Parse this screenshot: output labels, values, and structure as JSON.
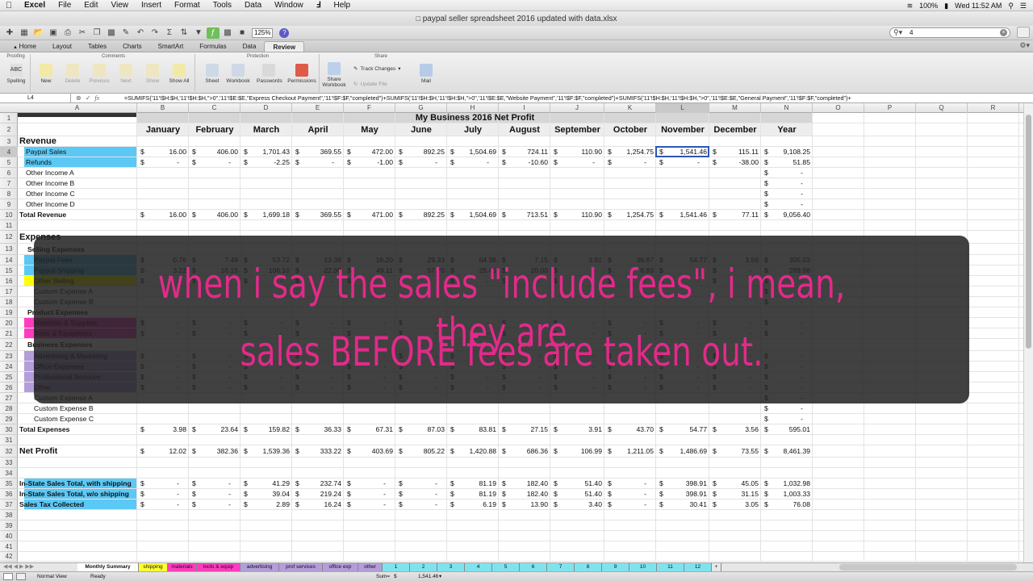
{
  "menubar": {
    "apple": "",
    "items": [
      "Excel",
      "File",
      "Edit",
      "View",
      "Insert",
      "Format",
      "Tools",
      "Data",
      "Window",
      "Help"
    ],
    "script_icon": "script-icon",
    "battery": "100%",
    "clock": "Wed 11:52 AM"
  },
  "window": {
    "title": "paypal seller spreadsheet 2016 updated with data.xlsx"
  },
  "toolbar": {
    "zoom": "125%",
    "search_value": "4"
  },
  "ribbon_tabs": [
    "Home",
    "Layout",
    "Tables",
    "Charts",
    "SmartArt",
    "Formulas",
    "Data",
    "Review"
  ],
  "ribbon_active": "Review",
  "ribbon": {
    "groups": {
      "proofing": "Proofing",
      "comments": "Comments",
      "protection": "Protection",
      "share": "Share"
    },
    "spelling": "Spelling",
    "new": "New",
    "delete": "Delete",
    "previous": "Previous",
    "next": "Next",
    "show": "Show",
    "show_all": "Show All",
    "sheet": "Sheet",
    "workbook": "Workbook",
    "passwords": "Passwords",
    "permissions": "Permissions",
    "share_workbook_1": "Share",
    "share_workbook_2": "Workbook",
    "track_changes": "Track Changes",
    "update_file": "Update File",
    "mail": "Mail"
  },
  "formula_bar": {
    "name_box": "L4",
    "fx": "fx",
    "formula": "=SUMIFS('11'!$H:$H,'11'!$H:$H,\">0\",'11'!$E:$E,\"Express Checkout Payment\",'11'!$F:$F,\"completed\")+SUMIFS('11'!$H:$H,'11'!$H:$H,\">0\",'11'!$E:$E,\"Website Payment\",'11'!$F:$F,\"completed\")+SUMIFS('11'!$H:$H,'11'!$H:$H,\">0\",'11'!$E:$E,\"General Payment\",'11'!$F:$F,\"completed\")+"
  },
  "columns": [
    "A",
    "B",
    "C",
    "D",
    "E",
    "F",
    "G",
    "H",
    "I",
    "J",
    "K",
    "L",
    "M",
    "N",
    "O",
    "P",
    "Q",
    "R"
  ],
  "rows": [
    "1",
    "2",
    "3",
    "4",
    "5",
    "6",
    "7",
    "8",
    "9",
    "10",
    "11",
    "12",
    "13",
    "14",
    "15",
    "16",
    "17",
    "18",
    "19",
    "20",
    "21",
    "22",
    "23",
    "24",
    "25",
    "26",
    "27",
    "28",
    "29",
    "30",
    "31",
    "32",
    "33",
    "34",
    "35",
    "36",
    "37",
    "38",
    "39",
    "40",
    "41",
    "42"
  ],
  "sheet": {
    "title": "My Business 2016 Net Profit",
    "months": [
      "January",
      "February",
      "March",
      "April",
      "May",
      "June",
      "July",
      "August",
      "September",
      "October",
      "November",
      "December",
      "Year"
    ],
    "labels": {
      "r3": "Revenue",
      "r4": "Paypal Sales",
      "r5": "Refunds",
      "r6": "Other Income A",
      "r7": "Other Income B",
      "r8": "Other Income C",
      "r9": "Other Income D",
      "r10": "Total Revenue",
      "r12": "Expenses",
      "r13": "Selling Expenses",
      "r14": "Paypal Fees",
      "r15": "Paypal Shipping",
      "r16": "Other Selling",
      "r17": "Custom Expense A",
      "r18": "Custom Expense B",
      "r19": "Product Expenses",
      "r20": "Materials & Supplies",
      "r21": "Tools & Equipment",
      "r22": "Business Expenses",
      "r23": "Advertising & Marketing",
      "r24": "Office Expenses",
      "r25": "Professional Services",
      "r26": "Other",
      "r27": "Custom Expense A",
      "r28": "Custom Expense B",
      "r29": "Custom Expense C",
      "r30": "Total Expenses",
      "r32": "Net Profit",
      "r35": "In-State Sales Total, with shipping",
      "r36": "In-State Sales Total, w/o shipping",
      "r37": "Sales Tax Collected"
    },
    "dollar": "$",
    "data": {
      "r4": [
        "16.00",
        "406.00",
        "1,701.43",
        "369.55",
        "472.00",
        "892.25",
        "1,504.69",
        "724.11",
        "110.90",
        "1,254.75",
        "1,541.46",
        "115.11",
        "9,108.25"
      ],
      "r5": [
        "-",
        "-",
        "-2.25",
        "-",
        "-1.00",
        "-",
        "-",
        "-10.60",
        "-",
        "-",
        "-",
        "-38.00",
        "51.85"
      ],
      "r6": [
        "",
        "",
        "",
        "",
        "",
        "",
        "",
        "",
        "",
        "",
        "",
        "",
        "-"
      ],
      "r7": [
        "",
        "",
        "",
        "",
        "",
        "",
        "",
        "",
        "",
        "",
        "",
        "",
        "-"
      ],
      "r8": [
        "",
        "",
        "",
        "",
        "",
        "",
        "",
        "",
        "",
        "",
        "",
        "",
        "-"
      ],
      "r9": [
        "",
        "",
        "",
        "",
        "",
        "",
        "",
        "",
        "",
        "",
        "",
        "",
        "-"
      ],
      "r10": [
        "16.00",
        "406.00",
        "1,699.18",
        "369.55",
        "471.00",
        "892.25",
        "1,504.69",
        "713.51",
        "110.90",
        "1,254.75",
        "1,541.46",
        "77.11",
        "9,056.40"
      ],
      "r14": [
        "0.76",
        "7.49",
        "53.72",
        "13.38",
        "18.20",
        "29.33",
        "54.36",
        "7.15",
        "3.91",
        "36.87",
        "54.77",
        "3.56",
        "305.03"
      ],
      "r15": [
        "3.22",
        "16.15",
        "106.10",
        "22.95",
        "49.11",
        "57.70",
        "29.45",
        "20.00",
        "-",
        "6.83",
        "-",
        "-",
        "289.98"
      ],
      "r16": [
        "-",
        "-",
        "-",
        "-",
        "-",
        "-",
        "-",
        "-",
        "-",
        "-",
        "-",
        "-",
        "-"
      ],
      "r17": [
        "",
        "",
        "",
        "",
        "",
        "",
        "",
        "",
        "",
        "",
        "",
        "",
        "-"
      ],
      "r18": [
        "",
        "",
        "",
        "",
        "",
        "",
        "",
        "",
        "",
        "",
        "",
        "",
        "-"
      ],
      "r20": [
        "-",
        "-",
        "-",
        "-",
        "-",
        "-",
        "-",
        "-",
        "-",
        "-",
        "-",
        "-",
        "-"
      ],
      "r21": [
        "-",
        "-",
        "-",
        "-",
        "-",
        "-",
        "-",
        "-",
        "-",
        "-",
        "-",
        "-",
        "-"
      ],
      "r23": [
        "-",
        "-",
        "-",
        "-",
        "-",
        "-",
        "-",
        "-",
        "-",
        "-",
        "-",
        "-",
        "-"
      ],
      "r24": [
        "-",
        "-",
        "-",
        "-",
        "-",
        "-",
        "-",
        "-",
        "-",
        "-",
        "-",
        "-",
        "-"
      ],
      "r25": [
        "-",
        "-",
        "-",
        "-",
        "-",
        "-",
        "-",
        "-",
        "-",
        "-",
        "-",
        "-",
        "-"
      ],
      "r26": [
        "-",
        "-",
        "-",
        "-",
        "-",
        "-",
        "-",
        "-",
        "-",
        "-",
        "-",
        "-",
        "-"
      ],
      "r27": [
        "",
        "",
        "",
        "",
        "",
        "",
        "",
        "",
        "",
        "",
        "",
        "",
        "-"
      ],
      "r28": [
        "",
        "",
        "",
        "",
        "",
        "",
        "",
        "",
        "",
        "",
        "",
        "",
        "-"
      ],
      "r29": [
        "",
        "",
        "",
        "",
        "",
        "",
        "",
        "",
        "",
        "",
        "",
        "",
        "-"
      ],
      "r30": [
        "3.98",
        "23.64",
        "159.82",
        "36.33",
        "67.31",
        "87.03",
        "83.81",
        "27.15",
        "3.91",
        "43.70",
        "54.77",
        "3.56",
        "595.01"
      ],
      "r32": [
        "12.02",
        "382.36",
        "1,539.36",
        "333.22",
        "403.69",
        "805.22",
        "1,420.88",
        "686.36",
        "106.99",
        "1,211.05",
        "1,486.69",
        "73.55",
        "8,461.39"
      ],
      "r35": [
        "-",
        "-",
        "41.29",
        "232.74",
        "-",
        "-",
        "81.19",
        "182.40",
        "51.40",
        "-",
        "398.91",
        "45.05",
        "1,032.98"
      ],
      "r36": [
        "-",
        "-",
        "39.04",
        "219.24",
        "-",
        "-",
        "81.19",
        "182.40",
        "51.40",
        "-",
        "398.91",
        "31.15",
        "1,003.33"
      ],
      "r37": [
        "-",
        "-",
        "2.89",
        "16.24",
        "-",
        "-",
        "6.19",
        "13.90",
        "3.40",
        "-",
        "30.41",
        "3.05",
        "76.08"
      ]
    }
  },
  "sheet_tabs": [
    "Monthly Summary",
    "shipping",
    "materials",
    "tools & equip",
    "advertising",
    "prof services",
    "office exp",
    "other",
    "1",
    "2",
    "3",
    "4",
    "5",
    "6",
    "7",
    "8",
    "9",
    "10",
    "11",
    "12",
    "+"
  ],
  "status": {
    "view": "Normal View",
    "ready": "Ready",
    "sum_label": "Sum=",
    "sum_dollar": "$",
    "sum_value": "1,541.46"
  },
  "caption": {
    "line1": "when i say the sales \"include fees\", i mean, they are",
    "line2": "sales BEFORE fees are taken out."
  },
  "colors": {
    "paypal_blue": "#5bc8f5",
    "yellow": "#ffff00",
    "pink": "#ff3cbf",
    "purple": "#b39ddb",
    "caption": "#e22a8a",
    "selection": "#2c55b8"
  }
}
